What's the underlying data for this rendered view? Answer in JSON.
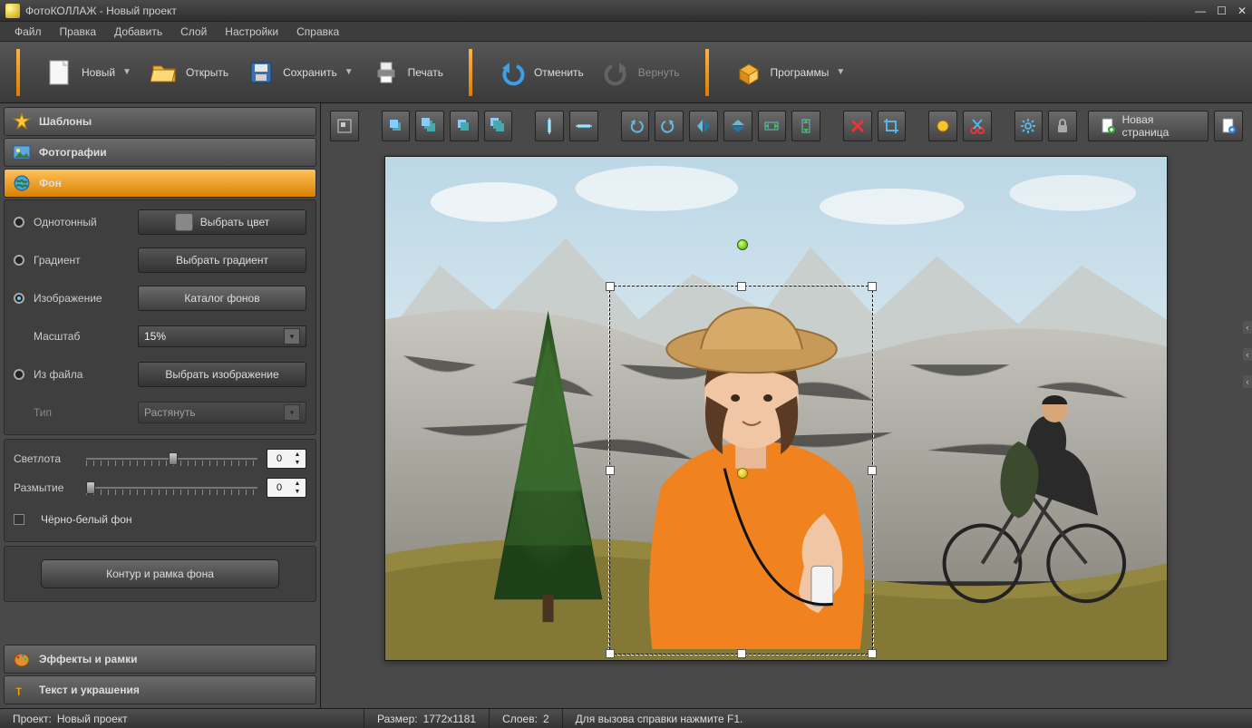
{
  "app": {
    "title": "ФотоКОЛЛАЖ - Новый проект"
  },
  "menu": {
    "file": "Файл",
    "edit": "Правка",
    "add": "Добавить",
    "layer": "Слой",
    "settings": "Настройки",
    "help": "Справка"
  },
  "toolbar": {
    "new": "Новый",
    "open": "Открыть",
    "save": "Сохранить",
    "print": "Печать",
    "undo": "Отменить",
    "redo": "Вернуть",
    "programs": "Программы"
  },
  "sidebar": {
    "templates": "Шаблоны",
    "photos": "Фотографии",
    "background": "Фон",
    "effects": "Эффекты и рамки",
    "text": "Текст и украшения"
  },
  "bg_panel": {
    "solid": "Однотонный",
    "choose_color": "Выбрать цвет",
    "gradient": "Градиент",
    "choose_gradient": "Выбрать градиент",
    "image": "Изображение",
    "bg_catalog": "Каталог фонов",
    "scale": "Масштаб",
    "scale_value": "15%",
    "from_file": "Из файла",
    "choose_image": "Выбрать изображение",
    "type": "Тип",
    "type_value": "Растянуть",
    "brightness": "Светлота",
    "brightness_value": "0",
    "blur": "Размытие",
    "blur_value": "0",
    "bw": "Чёрно-белый фон",
    "contour": "Контур и рамка фона"
  },
  "canvas_tools": {
    "new_page": "Новая страница"
  },
  "status": {
    "project": "Проект:",
    "project_name": "Новый проект",
    "size": "Размер:",
    "size_value": "1772x1181",
    "layers": "Слоев:",
    "layers_value": "2",
    "help_hint": "Для вызова справки нажмите F1."
  }
}
